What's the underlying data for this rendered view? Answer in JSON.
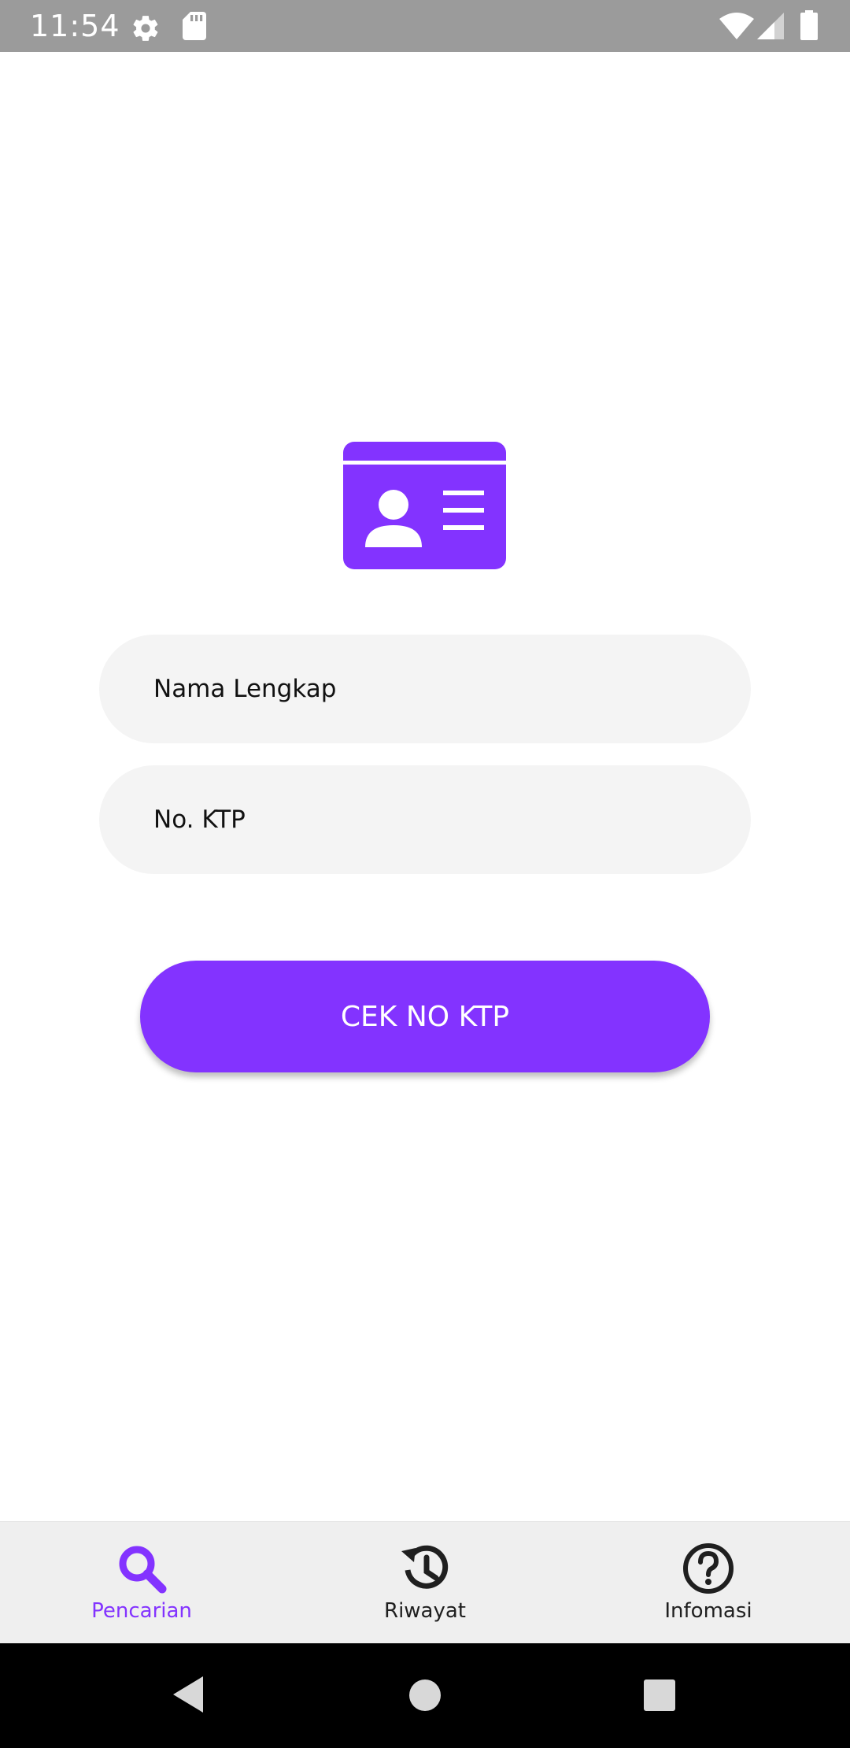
{
  "status_bar": {
    "time": "11:54",
    "icons": [
      "settings-icon",
      "sd-card-icon",
      "wifi-icon",
      "signal-icon",
      "battery-icon"
    ]
  },
  "theme": {
    "accent": "#8333ff",
    "input_background": "#f4f4f4",
    "nav_background": "#efefef",
    "status_bar_background": "#9b9b9b"
  },
  "form": {
    "name_placeholder": "Nama Lengkap",
    "ktp_placeholder": "No. KTP",
    "submit_label": "CEK NO KTP"
  },
  "bottom_nav": {
    "items": [
      {
        "label": "Pencarian",
        "icon": "search-icon",
        "active": true
      },
      {
        "label": "Riwayat",
        "icon": "history-icon",
        "active": false
      },
      {
        "label": "Infomasi",
        "icon": "help-icon",
        "active": false
      }
    ]
  },
  "system_nav": {
    "buttons": [
      "back-icon",
      "home-icon",
      "recents-icon"
    ]
  }
}
